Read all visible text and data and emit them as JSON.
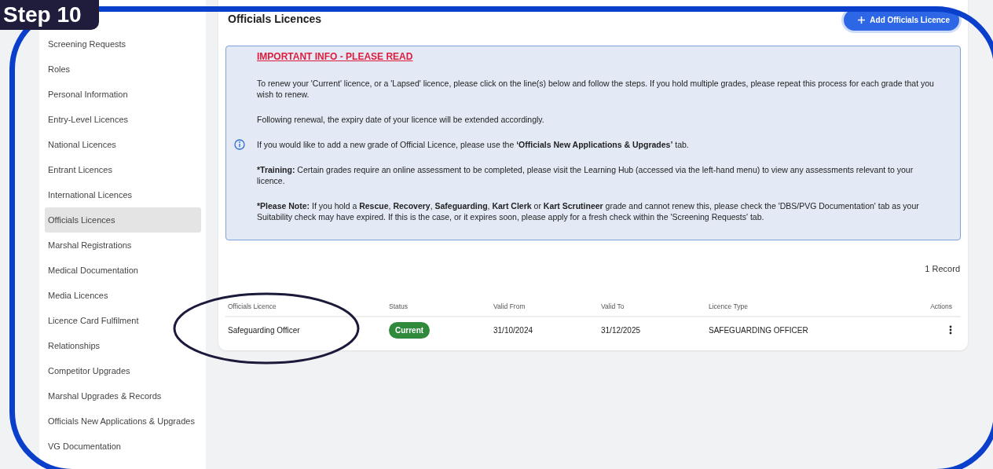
{
  "badge": {
    "label": "Step 10"
  },
  "sidebar": {
    "items": [
      {
        "label": "Screening Requests",
        "selected": false
      },
      {
        "label": "Roles",
        "selected": false
      },
      {
        "label": "Personal Information",
        "selected": false
      },
      {
        "label": "Entry-Level Licences",
        "selected": false
      },
      {
        "label": "National Licences",
        "selected": false
      },
      {
        "label": "Entrant Licences",
        "selected": false
      },
      {
        "label": "International Licences",
        "selected": false
      },
      {
        "label": "Officials Licences",
        "selected": true
      },
      {
        "label": "Marshal Registrations",
        "selected": false
      },
      {
        "label": "Medical Documentation",
        "selected": false
      },
      {
        "label": "Media Licences",
        "selected": false
      },
      {
        "label": "Licence Card Fulfilment",
        "selected": false
      },
      {
        "label": "Relationships",
        "selected": false
      },
      {
        "label": "Competitor Upgrades",
        "selected": false
      },
      {
        "label": "Marshal Upgrades & Records",
        "selected": false
      },
      {
        "label": "Officials New Applications & Upgrades",
        "selected": false
      },
      {
        "label": "VG Documentation",
        "selected": false
      }
    ]
  },
  "page": {
    "title": "Officials Licences",
    "add_button": "Add Officials Licence"
  },
  "info": {
    "heading": "IMPORTANT INFO - PLEASE READ",
    "paragraphs": [
      {
        "text": "To renew your 'Current' licence, or a 'Lapsed' licence, please click on the line(s) below and follow the steps. If you hold multiple grades, please repeat this process for each grade that you wish to renew.",
        "kind": "plain"
      },
      {
        "text": "Following renewal, the expiry date of your licence will be extended accordingly.",
        "kind": "plain"
      },
      {
        "text": "If you would like to add a new grade of Official Licence, please use the **‘Officials New Applications & Upgrades’** tab.",
        "kind": "info"
      },
      {
        "text": "***Training:** Certain grades require an online assessment to be completed, please visit the Learning Hub (accessed via the left-hand menu) to view any assessments relevant to your licence.",
        "kind": "plain"
      },
      {
        "text": "***Please Note:** If you hold a **Rescue**, **Recovery**, **Safeguarding**, **Kart Clerk** or **Kart Scrutineer** grade and cannot renew this, please check the 'DBS/PVG Documentation' tab as your Suitability check may have expired. If this is the case, or it expires soon, please apply for a fresh check within the 'Screening Requests' tab.",
        "kind": "plain"
      }
    ]
  },
  "table": {
    "record_count": "1 Record",
    "columns": [
      "Officials Licence",
      "Status",
      "Valid From",
      "Valid To",
      "Licence Type",
      "Actions"
    ],
    "rows": [
      {
        "officials_licence": "Safeguarding Officer",
        "status": "Current",
        "valid_from": "31/10/2024",
        "valid_to": "31/12/2025",
        "licence_type": "SAFEGUARDING OFFICER"
      }
    ]
  }
}
